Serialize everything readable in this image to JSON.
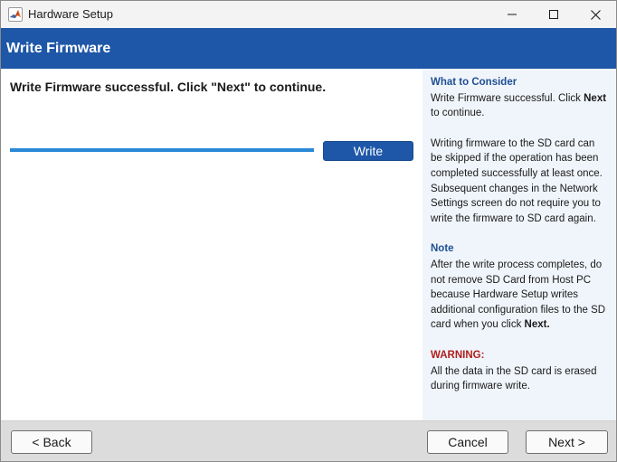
{
  "window": {
    "title": "Hardware Setup",
    "app_icon": "matlab-logo-icon",
    "controls": {
      "minimize": "minimize-icon",
      "maximize": "maximize-icon",
      "close": "close-icon"
    }
  },
  "header": {
    "title": "Write Firmware"
  },
  "main": {
    "status_text": "Write Firmware successful. Click \"Next\" to continue.",
    "progress_fraction": 1.0,
    "write_button": "Write"
  },
  "sidebar": {
    "consider_heading": "What to Consider",
    "consider_p1_a": "Write Firmware successful. Click ",
    "consider_p1_b": "Next",
    "consider_p1_c": " to continue.",
    "consider_p2": "Writing firmware to the SD card can be skipped if the operation has been completed successfully at least once. Subsequent changes in the Network Settings screen do not require you to write the firmware to SD card again.",
    "note_heading": "Note",
    "note_a": "After the write process completes, do not remove SD Card from Host PC because Hardware Setup writes additional configuration files to the SD card when you click ",
    "note_b": "Next.",
    "warning_heading": "WARNING:",
    "warning_text": "All the data in the SD card is erased during firmware write."
  },
  "footer": {
    "back": "< Back",
    "cancel": "Cancel",
    "next": "Next >"
  },
  "colors": {
    "header_band": "#1e57a7",
    "progress": "#2a88d6",
    "sidebar_bg": "#f0f5fb",
    "heading_blue": "#1f4f93",
    "warning_red": "#b01e1e"
  }
}
